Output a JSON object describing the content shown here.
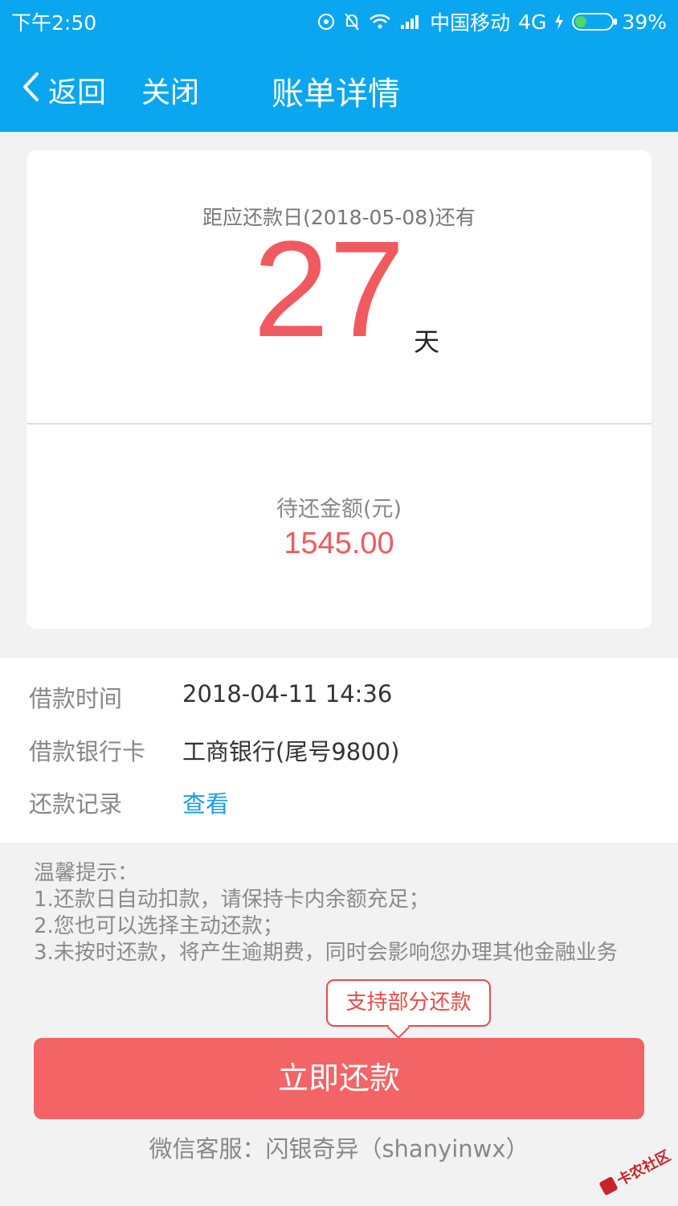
{
  "status_bar": {
    "time": "下午2:50",
    "carrier": "中国移动",
    "network": "4G",
    "battery": "39%"
  },
  "nav": {
    "back_label": "返回",
    "close_label": "关闭",
    "title": "账单详情"
  },
  "summary": {
    "due_label": "距应还款日(2018-05-08)还有",
    "days": "27",
    "days_unit": "天",
    "amount_label": "待还金额(元)",
    "amount": "1545.00"
  },
  "details": [
    {
      "label": "借款时间",
      "value": "2018-04-11 14:36"
    },
    {
      "label": "借款银行卡",
      "value": "工商银行(尾号9800)"
    },
    {
      "label": "还款记录",
      "value": "查看"
    }
  ],
  "tips": {
    "title": "温馨提示：",
    "lines": [
      "1.还款日自动扣款，请保持卡内余额充足；",
      "2.您也可以选择主动还款；",
      "3.未按时还款，将产生逾期费，同时会影响您办理其他金融业务"
    ]
  },
  "partial_badge": "支持部分还款",
  "pay_button": "立即还款",
  "service_text": "微信客服：闪银奇异（shanyinwx）",
  "watermark": "卡农社区",
  "colors": {
    "header": "#0aa6f0",
    "accent_red": "#f05a5f",
    "button": "#f26466",
    "link": "#1a9be8"
  }
}
